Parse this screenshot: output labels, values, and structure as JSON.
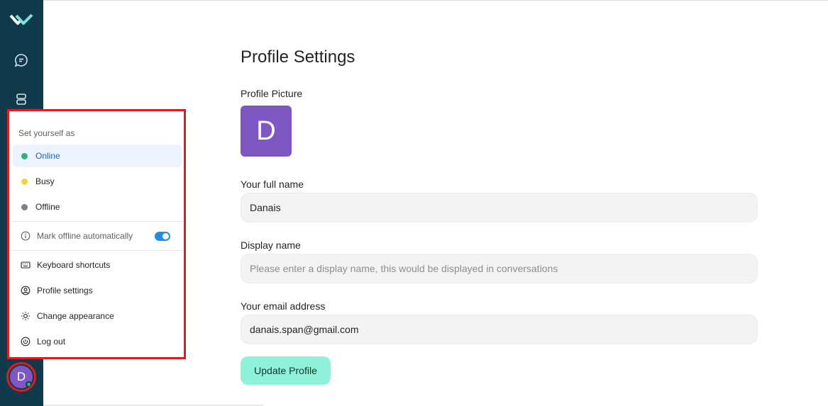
{
  "sidebar": {
    "logo": "app-logo",
    "icons": [
      "chat-bubble-icon",
      "server-icon"
    ],
    "user_initial": "D",
    "presence_color": "#2fb37a"
  },
  "status_menu": {
    "heading": "Set yourself as",
    "statuses": [
      {
        "label": "Online",
        "color": "#2fb37a",
        "active": true
      },
      {
        "label": "Busy",
        "color": "#f0d634",
        "active": false
      },
      {
        "label": "Offline",
        "color": "#7d8189",
        "active": false
      }
    ],
    "auto_offline": {
      "label": "Mark offline automatically",
      "icon": "info-icon",
      "enabled": true
    },
    "items": [
      {
        "label": "Keyboard shortcuts",
        "icon": "keyboard-icon"
      },
      {
        "label": "Profile settings",
        "icon": "user-circle-icon"
      },
      {
        "label": "Change appearance",
        "icon": "sun-icon"
      },
      {
        "label": "Log out",
        "icon": "power-icon"
      }
    ]
  },
  "profile": {
    "title": "Profile Settings",
    "picture_label": "Profile Picture",
    "picture_initial": "D",
    "full_name_label": "Your full name",
    "full_name_value": "Danais",
    "display_name_label": "Display name",
    "display_name_value": "",
    "display_name_placeholder": "Please enter a display name, this would be displayed in conversations",
    "email_label": "Your email address",
    "email_value": "danais.span@gmail.com",
    "update_button": "Update Profile"
  },
  "colors": {
    "sidebar_bg": "#0e3a4c",
    "avatar_bg": "#7e57c2",
    "accent_button": "#8ef2d8",
    "highlight": "#e01b24"
  }
}
